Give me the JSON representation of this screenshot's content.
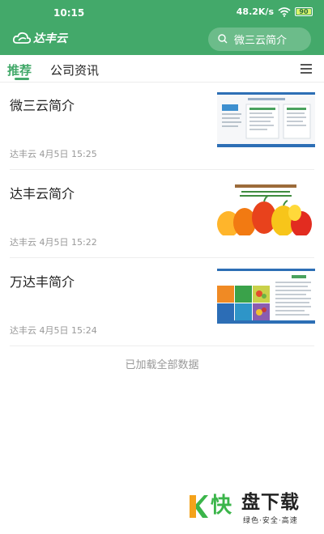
{
  "status_bar": {
    "time": "10:15",
    "speed": "48.2K/s",
    "battery": "90",
    "accent": "#43a96a"
  },
  "app_bar": {
    "logo_text": "达丰云",
    "search_text": "微三云简介"
  },
  "tabs": [
    {
      "label": "推荐",
      "active": true
    },
    {
      "label": "公司资讯",
      "active": false
    }
  ],
  "articles": [
    {
      "title": "微三云简介",
      "author": "达丰云",
      "date": "4月5日 15:25",
      "thumb_icon": "document-preview-thumbnail"
    },
    {
      "title": "达丰云简介",
      "author": "达丰云",
      "date": "4月5日 15:22",
      "thumb_icon": "peppers-photo-thumbnail"
    },
    {
      "title": "万达丰简介",
      "author": "达丰云",
      "date": "4月5日 15:24",
      "thumb_icon": "infographic-thumbnail"
    }
  ],
  "list_end_text": "已加载全部数据",
  "watermark": {
    "logo_char": "快",
    "name": "盘下载",
    "slogan": "绿色·安全·高速"
  }
}
